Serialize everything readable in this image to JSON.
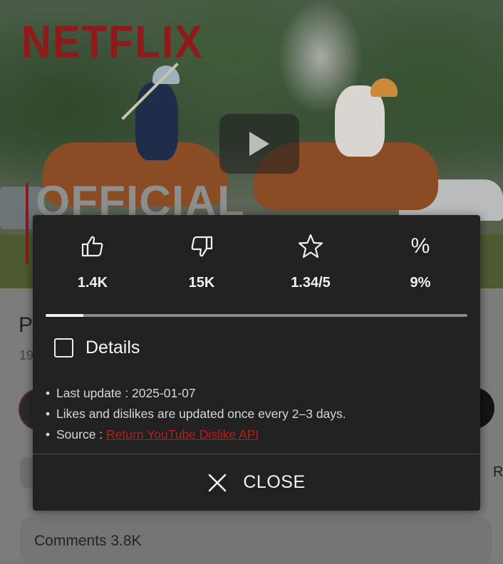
{
  "video": {
    "brand_text": "NETFLIX",
    "overlay_title_text": "OFFICIAL",
    "play_icon": "play-icon"
  },
  "page": {
    "title_partial": "P",
    "meta_partial": "19",
    "right_partial": "R",
    "comments_label": "Comments 3.8K"
  },
  "dialog": {
    "stats": [
      {
        "icon": "thumbs-up-icon",
        "value": "1.4K"
      },
      {
        "icon": "thumbs-down-icon",
        "value": "15K"
      },
      {
        "icon": "star-icon",
        "value": "1.34/5"
      },
      {
        "icon": "percent-icon",
        "glyph": "%",
        "value": "9%"
      }
    ],
    "ratio_fraction": 0.09,
    "details_label": "Details",
    "details_checked": false,
    "info": {
      "bullet": "•",
      "last_update": "Last update : 2025-01-07",
      "update_note": "Likes and dislikes are updated once every 2–3 days.",
      "source_prefix": "Source : ",
      "source_link": "Return YouTube Dislike API"
    },
    "close_label": "CLOSE"
  },
  "colors": {
    "dialog_bg": "#212121",
    "link_red": "#c01a1a",
    "brand_red": "#8e1a1a"
  }
}
